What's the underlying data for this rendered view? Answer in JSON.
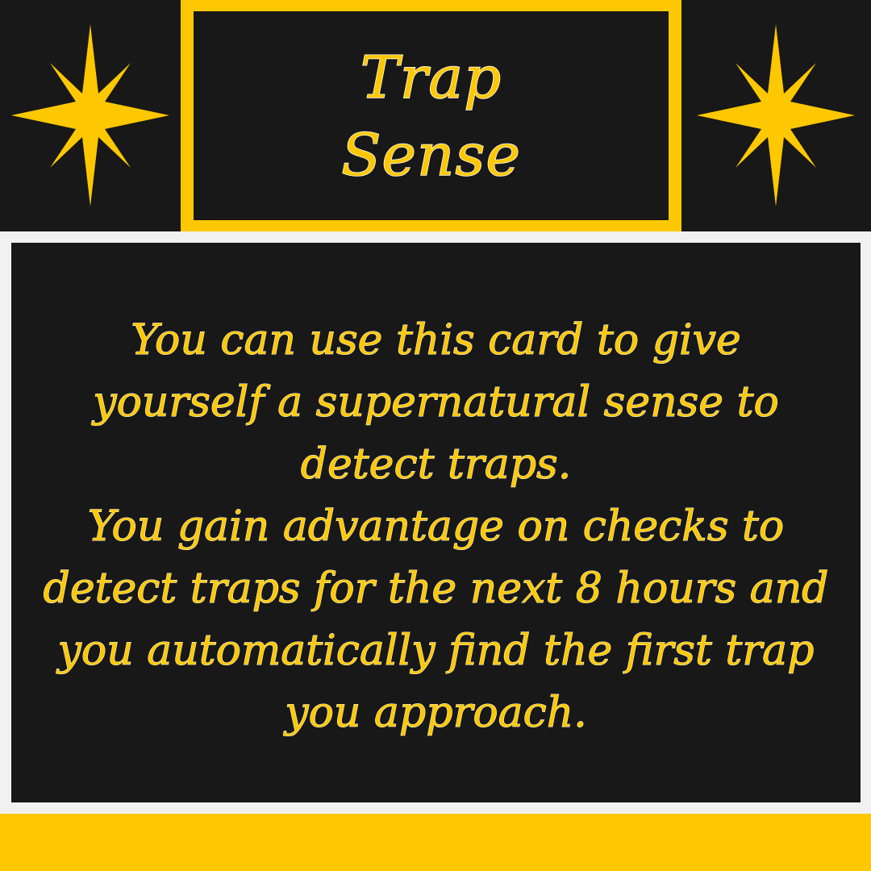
{
  "card": {
    "title_line_1": "Trap",
    "title_line_2": "Sense",
    "description_paragraph_1": "You can use this card to give yourself a supernatural sense to detect traps.",
    "description_paragraph_2": "You gain advantage on checks to detect traps for the next 8 hours and you automatically find the first trap you approach."
  },
  "decorations": {
    "left_icon": "eight-point-star-icon",
    "right_icon": "eight-point-star-icon"
  },
  "colors": {
    "accent_gold": "#fec800",
    "panel_black": "#181818",
    "frame_light": "#f1f1f1",
    "text_outline": "#ffffff"
  }
}
